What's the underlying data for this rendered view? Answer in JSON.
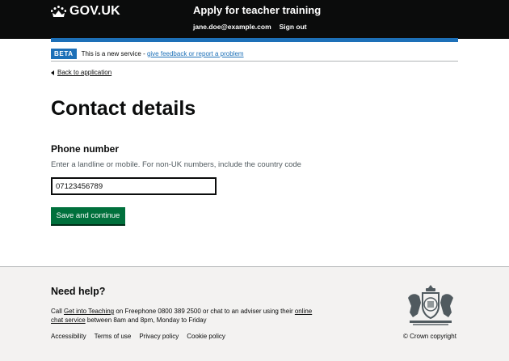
{
  "header": {
    "logo_text": "GOV.UK",
    "service_name": "Apply for teacher training",
    "nav": [
      "jane.doe@example.com",
      "Sign out"
    ]
  },
  "phase_banner": {
    "tag": "BETA",
    "text": "This is a new service - ",
    "link": "give feedback or report a problem"
  },
  "back_link": "Back to application",
  "main": {
    "title": "Contact details",
    "field_label": "Phone number",
    "field_hint": "Enter a landline or mobile. For non-UK numbers, include the country code",
    "phone_value": "07123456789",
    "save_label": "Save and continue"
  },
  "footer": {
    "help_title": "Need help?",
    "help_call": "Call ",
    "help_link1": "Get into Teaching",
    "help_mid": " on Freephone 0800 389 2500 or chat to an adviser using their ",
    "help_link2": "online chat service",
    "help_end": " between 8am and 8pm, Monday to Friday",
    "links": [
      "Accessibility",
      "Terms of use",
      "Privacy policy",
      "Cookie policy"
    ],
    "copyright": "© Crown copyright"
  },
  "colors": {
    "header_bg": "#0b0c0c",
    "brand_blue": "#1d70b8",
    "button_green": "#00703c",
    "footer_bg": "#f3f2f1"
  }
}
